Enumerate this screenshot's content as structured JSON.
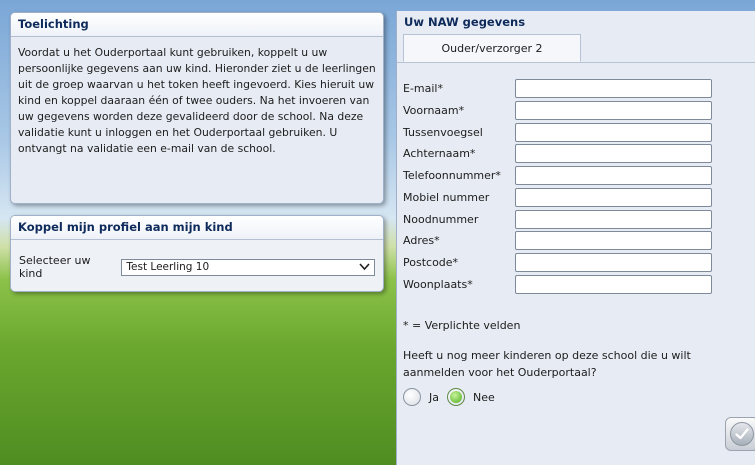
{
  "toelichting": {
    "title": "Toelichting",
    "body": "Voordat u het Ouderportaal kunt gebruiken, koppelt u uw persoonlijke gegevens aan uw kind. Hieronder ziet u de leerlingen uit de groep waarvan u het token heeft ingevoerd. Kies hieruit uw kind en koppel daaraan één of twee ouders. Na het invoeren van uw gegevens worden deze gevalideerd door de school. Na deze validatie kunt u inloggen en het Ouderportaal gebruiken. U ontvangt na validatie een e-mail van de school."
  },
  "koppel": {
    "title": "Koppel mijn profiel aan mijn kind",
    "select_label": "Selecteer uw kind",
    "selected_child": "Test Leerling 10"
  },
  "naw": {
    "title": "Uw NAW gegevens",
    "tab": "Ouder/verzorger 2",
    "fields": [
      {
        "label": "E-mail*",
        "value": ""
      },
      {
        "label": "Voornaam*",
        "value": ""
      },
      {
        "label": "Tussenvoegsel",
        "value": ""
      },
      {
        "label": "Achternaam*",
        "value": ""
      },
      {
        "label": "Telefoonnummer*",
        "value": ""
      },
      {
        "label": "Mobiel nummer",
        "value": ""
      },
      {
        "label": "Noodnummer",
        "value": ""
      },
      {
        "label": "Adres*",
        "value": ""
      },
      {
        "label": "Postcode*",
        "value": ""
      },
      {
        "label": "Woonplaats*",
        "value": ""
      }
    ],
    "required_note": "* = Verplichte velden",
    "question": "Heeft u nog meer kinderen op deze school die u wilt aanmelden voor het Ouderportaal?",
    "options": {
      "ja": "Ja",
      "nee": "Nee"
    },
    "selected_option": "Nee"
  },
  "icons": {
    "select": "chevron-down-icon",
    "submit": "checkmark-icon"
  }
}
